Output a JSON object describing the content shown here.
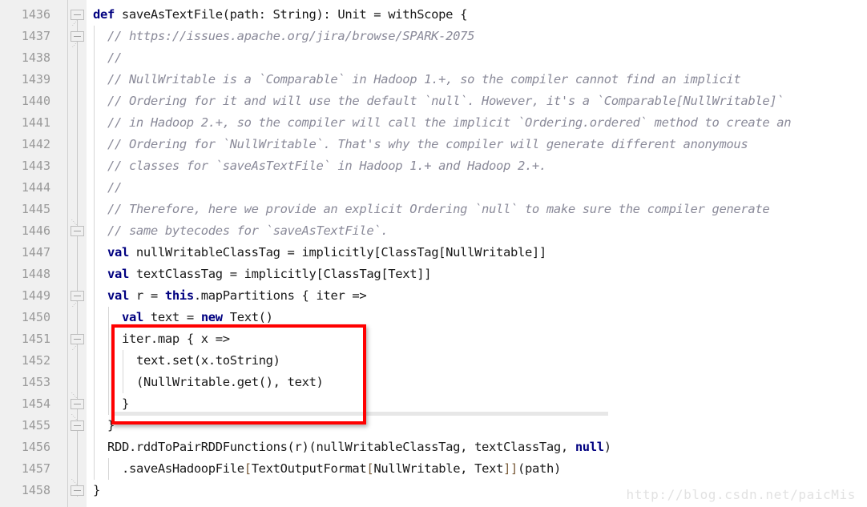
{
  "editor": {
    "language": "scala",
    "first_line_number": 1436,
    "gutter_background": "#f0f0f0",
    "code_background": "#ffffff",
    "keyword_color": "#000080",
    "comment_color": "#8a8a99",
    "line_number_color": "#9a9a9a",
    "annotation_color": "#ff0000"
  },
  "line_numbers": [
    "1436",
    "1437",
    "1438",
    "1439",
    "1440",
    "1441",
    "1442",
    "1443",
    "1444",
    "1445",
    "1446",
    "1447",
    "1448",
    "1449",
    "1450",
    "1451",
    "1452",
    "1453",
    "1454",
    "1455",
    "1456",
    "1457",
    "1458"
  ],
  "fold_markers": [
    {
      "line_index": 0,
      "type": "fold-start",
      "name": "fold-marker-1436"
    },
    {
      "line_index": 1,
      "type": "fold-start",
      "name": "fold-marker-1437"
    },
    {
      "line_index": 10,
      "type": "fold-end",
      "name": "fold-marker-1446"
    },
    {
      "line_index": 13,
      "type": "fold-start",
      "name": "fold-marker-1449"
    },
    {
      "line_index": 15,
      "type": "fold-start",
      "name": "fold-marker-1451"
    },
    {
      "line_index": 18,
      "type": "fold-end",
      "name": "fold-marker-1454"
    },
    {
      "line_index": 19,
      "type": "fold-end",
      "name": "fold-marker-1455"
    },
    {
      "line_index": 22,
      "type": "fold-end",
      "name": "fold-marker-1458"
    }
  ],
  "code_lines": [
    {
      "n": "1436",
      "indent": 0,
      "text": "def saveAsTextFile(path: String): Unit = withScope {",
      "tokens": [
        {
          "t": "def",
          "c": "kw"
        },
        {
          "t": " saveAsTextFile(path: String): Unit = withScope {",
          "c": ""
        }
      ]
    },
    {
      "n": "1437",
      "indent": 1,
      "text": "// https://issues.apache.org/jira/browse/SPARK-2075",
      "tokens": [
        {
          "t": "// https://issues.apache.org/jira/browse/SPARK-2075",
          "c": "cmt"
        }
      ]
    },
    {
      "n": "1438",
      "indent": 1,
      "text": "//",
      "tokens": [
        {
          "t": "//",
          "c": "cmt"
        }
      ]
    },
    {
      "n": "1439",
      "indent": 1,
      "text": "// NullWritable is a `Comparable` in Hadoop 1.+, so the compiler cannot find an implicit",
      "tokens": [
        {
          "t": "// NullWritable is a `Comparable` in Hadoop 1.+, so the compiler cannot find an implicit",
          "c": "cmt"
        }
      ]
    },
    {
      "n": "1440",
      "indent": 1,
      "text": "// Ordering for it and will use the default `null`. However, it's a `Comparable[NullWritable]`",
      "tokens": [
        {
          "t": "// Ordering for it and will use the default `null`. However, it's a `Comparable[NullWritable]`",
          "c": "cmt"
        }
      ]
    },
    {
      "n": "1441",
      "indent": 1,
      "text": "// in Hadoop 2.+, so the compiler will call the implicit `Ordering.ordered` method to create an",
      "tokens": [
        {
          "t": "// in Hadoop 2.+, so the compiler will call the implicit `Ordering.ordered` method to create an",
          "c": "cmt"
        }
      ]
    },
    {
      "n": "1442",
      "indent": 1,
      "text": "// Ordering for `NullWritable`. That's why the compiler will generate different anonymous",
      "tokens": [
        {
          "t": "// Ordering for `NullWritable`. That's why the compiler will generate different anonymous",
          "c": "cmt"
        }
      ]
    },
    {
      "n": "1443",
      "indent": 1,
      "text": "// classes for `saveAsTextFile` in Hadoop 1.+ and Hadoop 2.+.",
      "tokens": [
        {
          "t": "// classes for `saveAsTextFile` in Hadoop 1.+ and Hadoop 2.+.",
          "c": "cmt"
        }
      ]
    },
    {
      "n": "1444",
      "indent": 1,
      "text": "//",
      "tokens": [
        {
          "t": "//",
          "c": "cmt"
        }
      ]
    },
    {
      "n": "1445",
      "indent": 1,
      "text": "// Therefore, here we provide an explicit Ordering `null` to make sure the compiler generate",
      "tokens": [
        {
          "t": "// Therefore, here we provide an explicit Ordering `null` to make sure the compiler generate",
          "c": "cmt"
        }
      ]
    },
    {
      "n": "1446",
      "indent": 1,
      "text": "// same bytecodes for `saveAsTextFile`.",
      "tokens": [
        {
          "t": "// same bytecodes for `saveAsTextFile`.",
          "c": "cmt"
        }
      ]
    },
    {
      "n": "1447",
      "indent": 1,
      "text": "val nullWritableClassTag = implicitly[ClassTag[NullWritable]]",
      "tokens": [
        {
          "t": "val",
          "c": "kw"
        },
        {
          "t": " nullWritableClassTag = implicitly[ClassTag[NullWritable]]",
          "c": ""
        }
      ]
    },
    {
      "n": "1448",
      "indent": 1,
      "text": "val textClassTag = implicitly[ClassTag[Text]]",
      "tokens": [
        {
          "t": "val",
          "c": "kw"
        },
        {
          "t": " textClassTag = implicitly[ClassTag[Text]]",
          "c": ""
        }
      ]
    },
    {
      "n": "1449",
      "indent": 1,
      "text": "val r = this.mapPartitions { iter =>",
      "tokens": [
        {
          "t": "val",
          "c": "kw"
        },
        {
          "t": " r = ",
          "c": ""
        },
        {
          "t": "this",
          "c": "kw"
        },
        {
          "t": ".mapPartitions { iter =>",
          "c": ""
        }
      ]
    },
    {
      "n": "1450",
      "indent": 2,
      "text": "val text = new Text()",
      "tokens": [
        {
          "t": "val",
          "c": "kw"
        },
        {
          "t": " text = ",
          "c": ""
        },
        {
          "t": "new",
          "c": "kw"
        },
        {
          "t": " Text()",
          "c": ""
        }
      ]
    },
    {
      "n": "1451",
      "indent": 2,
      "text": "iter.map { x =>",
      "tokens": [
        {
          "t": "iter.map { x =>",
          "c": ""
        }
      ]
    },
    {
      "n": "1452",
      "indent": 3,
      "text": "text.set(x.toString)",
      "tokens": [
        {
          "t": "text.set(x.toString)",
          "c": ""
        }
      ]
    },
    {
      "n": "1453",
      "indent": 3,
      "text": "(NullWritable.get(), text)",
      "tokens": [
        {
          "t": "(NullWritable.get(), text)",
          "c": ""
        }
      ]
    },
    {
      "n": "1454",
      "indent": 2,
      "text": "}",
      "tokens": [
        {
          "t": "}",
          "c": ""
        }
      ]
    },
    {
      "n": "1455",
      "indent": 1,
      "text": "}",
      "tokens": [
        {
          "t": "}",
          "c": ""
        }
      ]
    },
    {
      "n": "1456",
      "indent": 1,
      "text": "RDD.rddToPairRDDFunctions(r)(nullWritableClassTag, textClassTag, null)",
      "tokens": [
        {
          "t": "RDD.rddToPairRDDFunctions(r)(nullWritableClassTag, textClassTag, ",
          "c": ""
        },
        {
          "t": "null",
          "c": "kw"
        },
        {
          "t": ")",
          "c": ""
        }
      ]
    },
    {
      "n": "1457",
      "indent": 2,
      "text": ".saveAsHadoopFile[TextOutputFormat[NullWritable, Text]](path)",
      "tokens": [
        {
          "t": ".saveAsHadoopFile",
          "c": ""
        },
        {
          "t": "[",
          "c": "brk"
        },
        {
          "t": "TextOutputFormat",
          "c": ""
        },
        {
          "t": "[",
          "c": "brk"
        },
        {
          "t": "NullWritable, Text",
          "c": ""
        },
        {
          "t": "]]",
          "c": "brk"
        },
        {
          "t": "(path)",
          "c": ""
        }
      ]
    },
    {
      "n": "1458",
      "indent": 0,
      "text": "}",
      "tokens": [
        {
          "t": "}",
          "c": ""
        }
      ]
    }
  ],
  "annotation": {
    "name": "red-highlight-box",
    "color": "#ff0000",
    "covers_lines": [
      "1451",
      "1452",
      "1453",
      "1454"
    ]
  },
  "watermark": {
    "text": "http://blog.csdn.net/paicMis"
  }
}
